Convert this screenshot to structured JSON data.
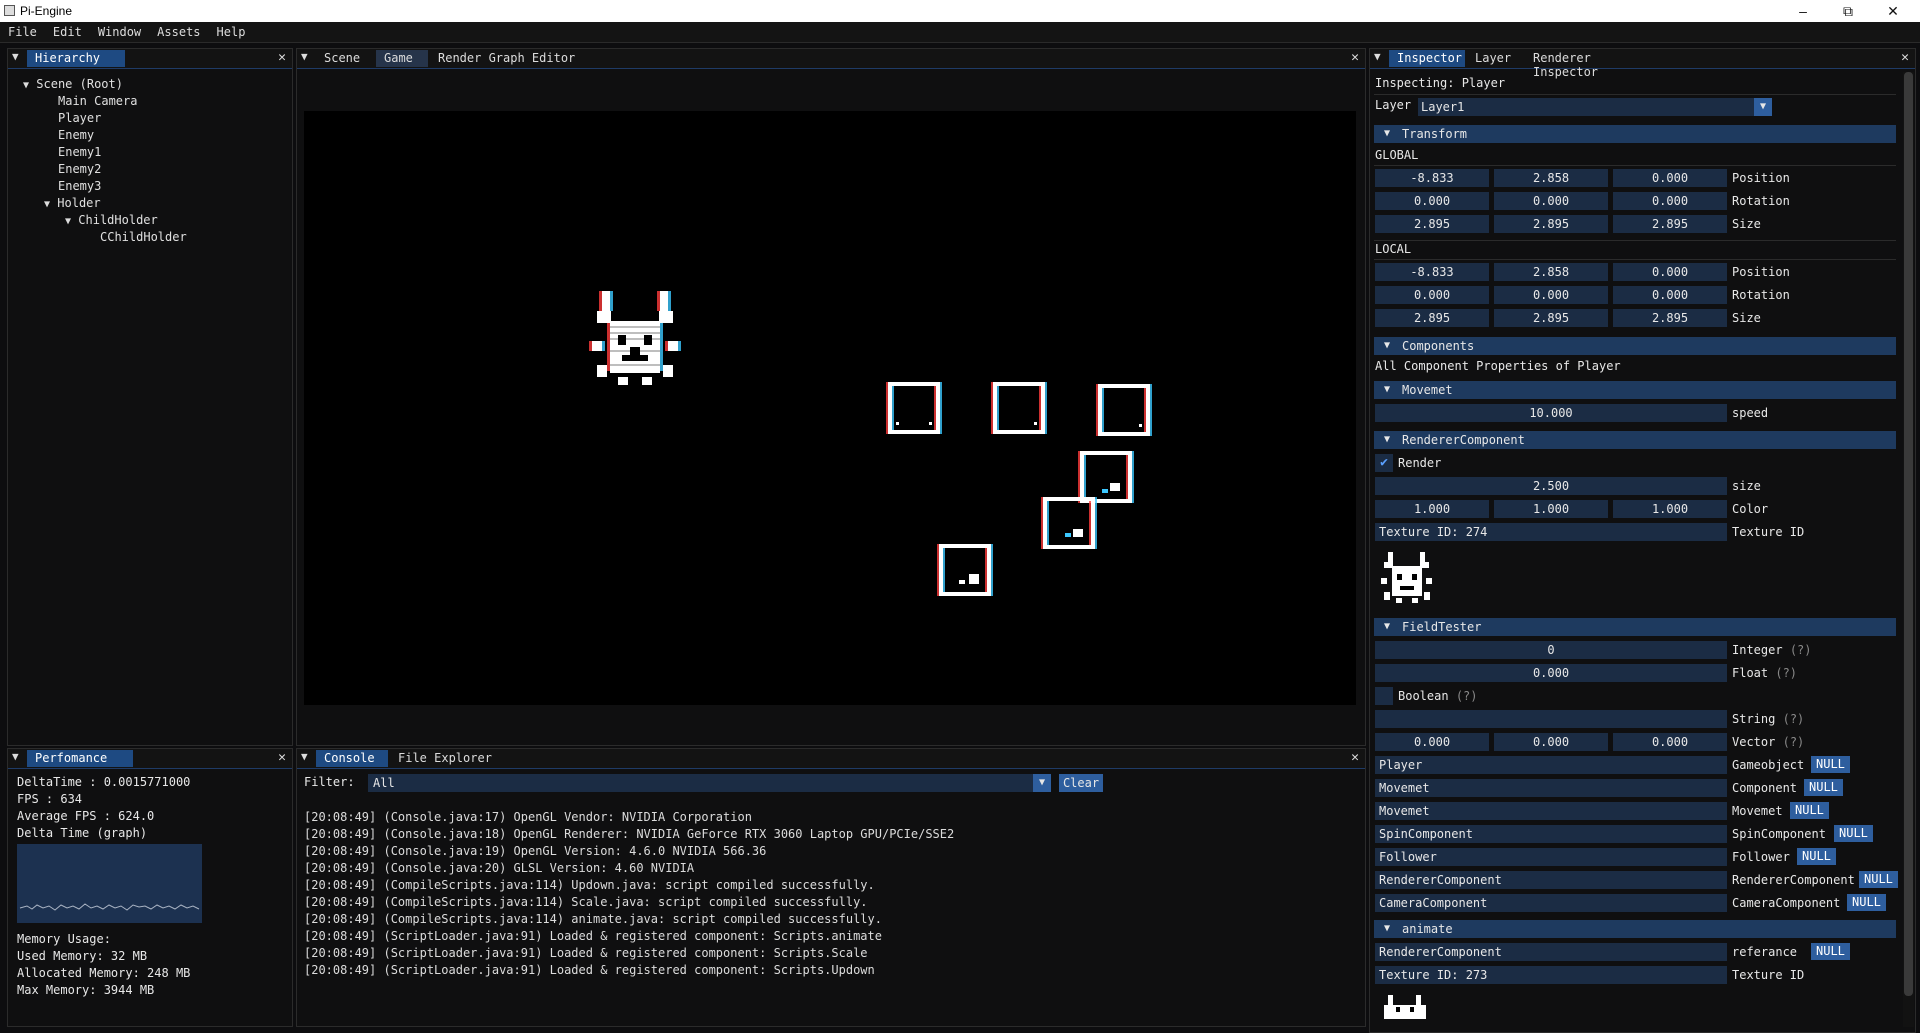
{
  "window": {
    "title": "Pi-Engine"
  },
  "menu": [
    "File",
    "Edit",
    "Window",
    "Assets",
    "Help"
  ],
  "hierarchy": {
    "tab": "Hierarchy",
    "items": [
      {
        "label": "Scene (Root)",
        "expanded": true
      },
      {
        "label": "Main Camera"
      },
      {
        "label": "Player"
      },
      {
        "label": "Enemy"
      },
      {
        "label": "Enemy1"
      },
      {
        "label": "Enemy2"
      },
      {
        "label": "Enemy3"
      },
      {
        "label": "Holder",
        "expanded": true
      },
      {
        "label": "ChildHolder",
        "expanded": true
      },
      {
        "label": "CChildHolder"
      }
    ]
  },
  "center": {
    "tabs": [
      "Scene",
      "Game",
      "Render Graph Editor"
    ],
    "active_tab": "Game"
  },
  "performance": {
    "tab": "Perfomance",
    "lines": [
      "DeltaTime : 0.0015771000",
      "FPS : 634",
      "Average FPS : 624.0",
      "Delta Time (graph)"
    ],
    "memory": [
      "Memory Usage:",
      "Used Memory: 32 MB",
      "Allocated Memory: 248 MB",
      "Max Memory: 3944 MB"
    ]
  },
  "console": {
    "tabs": [
      "Console",
      "File Explorer"
    ],
    "filter_label": "Filter:",
    "filter_value": "All",
    "clear_label": "Clear",
    "lines": [
      "[20:08:49] (Console.java:17) OpenGL Vendor: NVIDIA Corporation",
      "[20:08:49] (Console.java:18) OpenGL Renderer: NVIDIA GeForce RTX 3060 Laptop GPU/PCIe/SSE2",
      "[20:08:49] (Console.java:19) OpenGL Version: 4.6.0 NVIDIA 566.36",
      "[20:08:49] (Console.java:20) GLSL Version: 4.60 NVIDIA",
      "[20:08:49] (CompileScripts.java:114) Updown.java: script compiled successfully.",
      "[20:08:49] (CompileScripts.java:114) Scale.java: script compiled successfully.",
      "[20:08:49] (CompileScripts.java:114) animate.java: script compiled successfully.",
      "[20:08:49] (ScriptLoader.java:91) Loaded & registered component: Scripts.animate",
      "[20:08:49] (ScriptLoader.java:91) Loaded & registered component: Scripts.Scale",
      "[20:08:49] (ScriptLoader.java:91) Loaded & registered component: Scripts.Updown"
    ]
  },
  "inspector": {
    "tabs": [
      "Inspector",
      "Layer",
      "Renderer Inspector"
    ],
    "inspecting": "Inspecting: Player",
    "layer_label": "Layer",
    "layer_value": "Layer1",
    "transform": {
      "header": "Transform",
      "global_label": "GLOBAL",
      "local_label": "LOCAL",
      "global": [
        {
          "v": [
            "-8.833",
            "2.858",
            "0.000"
          ],
          "label": "Position"
        },
        {
          "v": [
            "0.000",
            "0.000",
            "0.000"
          ],
          "label": "Rotation"
        },
        {
          "v": [
            "2.895",
            "2.895",
            "2.895"
          ],
          "label": "Size"
        }
      ],
      "local": [
        {
          "v": [
            "-8.833",
            "2.858",
            "0.000"
          ],
          "label": "Position"
        },
        {
          "v": [
            "0.000",
            "0.000",
            "0.000"
          ],
          "label": "Rotation"
        },
        {
          "v": [
            "2.895",
            "2.895",
            "2.895"
          ],
          "label": "Size"
        }
      ]
    },
    "components": {
      "header": "Components",
      "sub": "All Component Properties of Player"
    },
    "movemet": {
      "header": "Movemet",
      "speed_value": "10.000",
      "speed_label": "speed"
    },
    "renderer": {
      "header": "RendererComponent",
      "render_label": "Render",
      "render_checked": true,
      "size_value": "2.500",
      "size_label": "size",
      "color": [
        "1.000",
        "1.000",
        "1.000"
      ],
      "color_label": "Color",
      "texture_value": "Texture ID: 274",
      "texture_label": "Texture ID"
    },
    "fieldtester": {
      "header": "FieldTester",
      "integer_value": "0",
      "integer_label": "Integer",
      "float_value": "0.000",
      "float_label": "Float",
      "boolean_label": "Boolean",
      "string_value": "",
      "string_label": "String",
      "vector": [
        "0.000",
        "0.000",
        "0.000"
      ],
      "vector_label": "Vector",
      "help": "(?)",
      "refs": [
        {
          "value": "Player",
          "label": "Gameobject",
          "btn": "NULL"
        },
        {
          "value": "Movemet",
          "label": "Component",
          "btn": "NULL"
        },
        {
          "value": "Movemet",
          "label": "Movemet",
          "btn": "NULL"
        },
        {
          "value": "SpinComponent",
          "label": "SpinComponent",
          "btn": "NULL"
        },
        {
          "value": "Follower",
          "label": "Follower",
          "btn": "NULL"
        },
        {
          "value": "RendererComponent",
          "label": "RendererComponent",
          "btn": "NULL"
        },
        {
          "value": "CameraComponent",
          "label": "CameraComponent",
          "btn": "NULL"
        }
      ]
    },
    "animate": {
      "header": "animate",
      "ref_value": "RendererComponent",
      "ref_label": "referance",
      "ref_btn": "NULL",
      "texture_value": "Texture ID: 273",
      "texture_label": "Texture ID"
    }
  }
}
